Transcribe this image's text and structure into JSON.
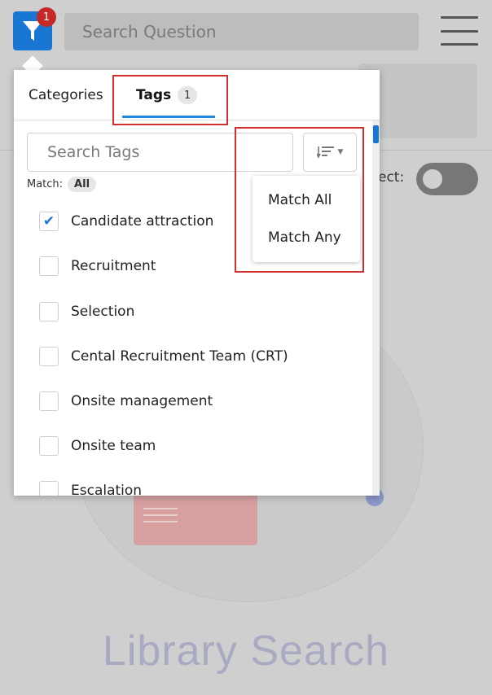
{
  "header": {
    "filter_badge": "1",
    "search_placeholder": "Search Question"
  },
  "background": {
    "select_label": "ect:",
    "title": "Library Search"
  },
  "filter_popup": {
    "tabs": [
      {
        "label": "Categories"
      },
      {
        "label": "Tags",
        "count": "1",
        "active": true
      }
    ],
    "tag_search_placeholder": "Search Tags",
    "match_label": "Match:",
    "match_value": "All",
    "tags": [
      {
        "label": "Candidate attraction",
        "checked": true
      },
      {
        "label": "Recruitment",
        "checked": false
      },
      {
        "label": "Selection",
        "checked": false
      },
      {
        "label": "Cental Recruitment Team (CRT)",
        "checked": false
      },
      {
        "label": "Onsite management",
        "checked": false
      },
      {
        "label": "Onsite team",
        "checked": false
      },
      {
        "label": "Escalation",
        "checked": false
      }
    ]
  },
  "match_menu": {
    "items": [
      {
        "label": "Match All"
      },
      {
        "label": "Match Any"
      }
    ]
  },
  "colors": {
    "accent": "#1976d2",
    "badge": "#c62828",
    "highlight_box": "#d32f2f"
  }
}
